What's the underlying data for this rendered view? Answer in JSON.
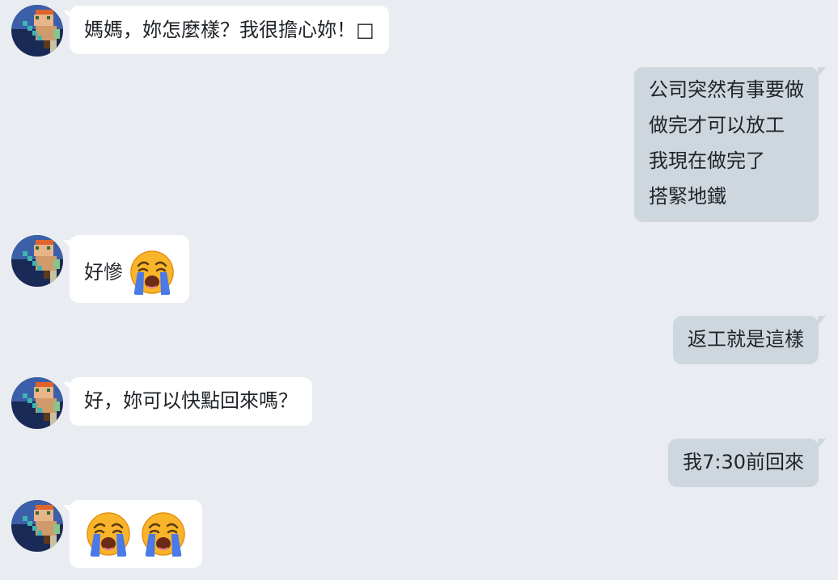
{
  "messages": [
    {
      "side": "in",
      "text": "媽媽，妳怎麼樣？我很擔心妳！□"
    },
    {
      "side": "out",
      "lines": [
        "公司突然有事要做",
        "做完才可以放工",
        "我現在做完了",
        "搭緊地鐵"
      ]
    },
    {
      "side": "in",
      "text": "好慘",
      "emoji": "loudly-crying-face-icon"
    },
    {
      "side": "out",
      "text": "返工就是這樣"
    },
    {
      "side": "in",
      "text": "好，妳可以快點回來嗎？"
    },
    {
      "side": "out",
      "text": "我7:30前回來"
    },
    {
      "side": "in",
      "emojis": [
        "loudly-crying-face-icon",
        "loudly-crying-face-icon"
      ]
    }
  ],
  "colors": {
    "background": "#e9ecf0",
    "incoming_bubble": "#ffffff",
    "outgoing_bubble": "#cfd7de",
    "text": "#202428"
  }
}
